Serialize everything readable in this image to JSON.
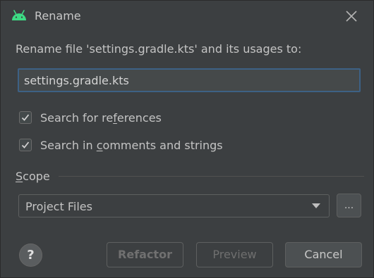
{
  "window": {
    "title": "Rename",
    "icon": "android-icon",
    "close_icon": "close-icon"
  },
  "prompt": "Rename file 'settings.gradle.kts' and its usages to:",
  "name_input": {
    "value": "settings.gradle.kts"
  },
  "options": [
    {
      "pre": "Search for re",
      "mnemonic": "f",
      "post": "erences",
      "checked": true
    },
    {
      "pre": "Search in ",
      "mnemonic": "c",
      "post": "omments and strings",
      "checked": true
    }
  ],
  "scope": {
    "label_mnemonic": "S",
    "label_rest": "cope",
    "selected": "Project Files",
    "more_label": "..."
  },
  "buttons": {
    "help": "?",
    "refactor": "Refactor",
    "preview": "Preview",
    "cancel": "Cancel"
  },
  "colors": {
    "background": "#3c3f41",
    "input_focus_border": "#3d6185",
    "android_green": "#3ddc84"
  }
}
